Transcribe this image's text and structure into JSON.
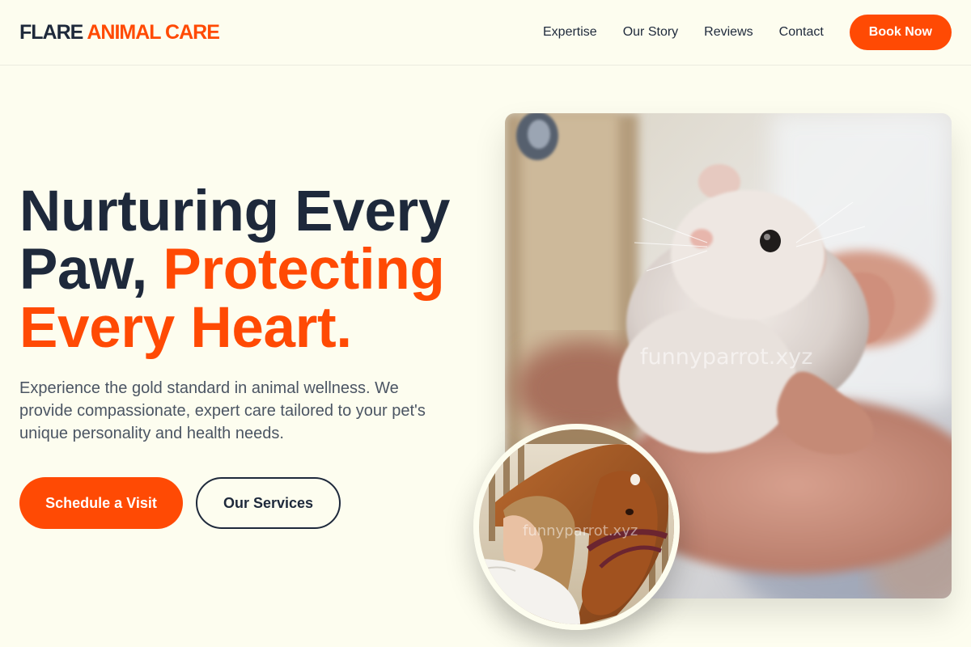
{
  "brand": {
    "name_part1": "FLARE",
    "name_part2": "ANIMAL CARE"
  },
  "nav": {
    "links": [
      {
        "label": "Expertise"
      },
      {
        "label": "Our Story"
      },
      {
        "label": "Reviews"
      },
      {
        "label": "Contact"
      }
    ],
    "cta_label": "Book Now"
  },
  "hero": {
    "title_line1": "Nurturing Every",
    "title_line2_dark": "Paw,",
    "title_line2_accent": "Protecting",
    "title_line3": "Every Heart.",
    "description": "Experience the gold standard in animal wellness. We provide compassionate, expert care tailored to your pet's unique personality and health needs.",
    "primary_cta": "Schedule a Visit",
    "secondary_cta": "Our Services"
  },
  "images": {
    "main_watermark": "funnyparrot.xyz",
    "circle_watermark": "funnyparrot.xyz",
    "main_icon": "hamster-photo",
    "circle_icon": "horse-photo"
  },
  "colors": {
    "accent": "#ff4a04",
    "text_dark": "#1e293b",
    "text_muted": "#4b5563",
    "background": "#fdfdef"
  }
}
